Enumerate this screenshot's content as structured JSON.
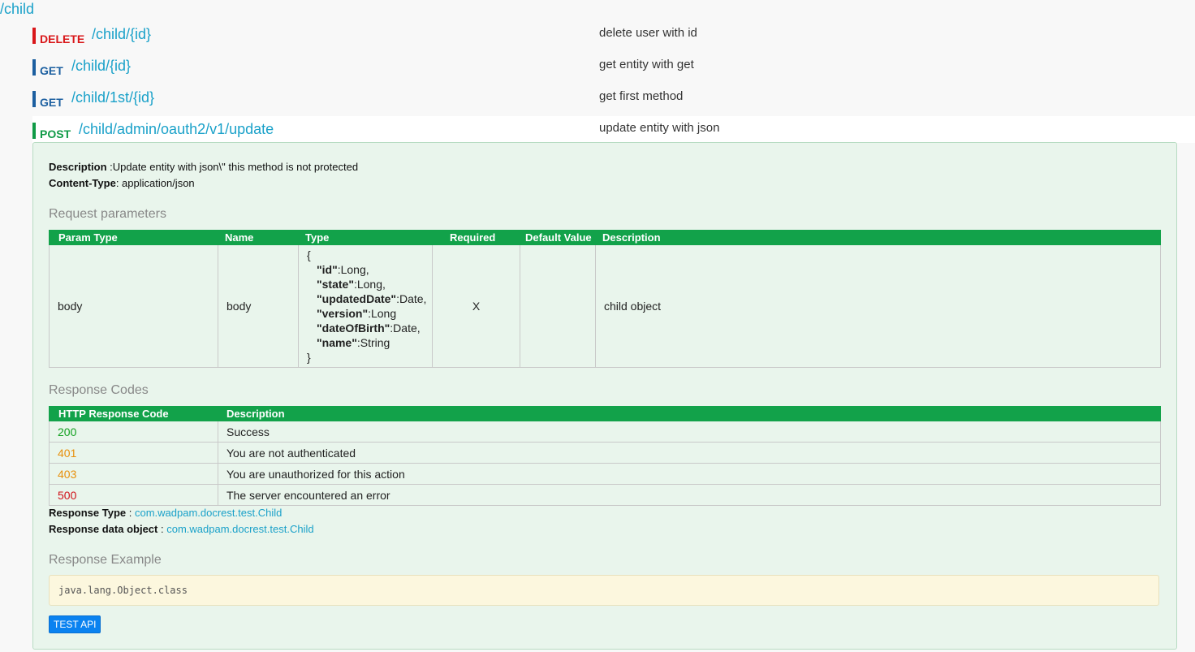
{
  "group": {
    "title": "/child"
  },
  "endpoints": [
    {
      "method": "DELETE",
      "path": "/child/{id}",
      "summary": "delete user with id"
    },
    {
      "method": "GET",
      "path": "/child/{id}",
      "summary": "get entity with get"
    },
    {
      "method": "GET",
      "path": "/child/1st/{id}",
      "summary": "get first method"
    },
    {
      "method": "POST",
      "path": "/child/admin/oauth2/v1/update",
      "summary": "update entity with json"
    }
  ],
  "details": {
    "description_label": "Description",
    "description_value": " :Update entity with json\\\" this method is not protected",
    "content_type_label": "Content-Type",
    "content_type_value": ": application/json",
    "request_params_title": "Request parameters",
    "param_headers": [
      "Param Type",
      "Name",
      "Type",
      "Required",
      "Default Value",
      "Description"
    ],
    "param_row": {
      "param_type": "body",
      "name": "body",
      "type_open": "{",
      "type_close": "}",
      "fields": [
        {
          "key": "\"id\"",
          "val": ":Long,"
        },
        {
          "key": "\"state\"",
          "val": ":Long,"
        },
        {
          "key": "\"updatedDate\"",
          "val": ":Date,"
        },
        {
          "key": "\"version\"",
          "val": ":Long"
        },
        {
          "key": "\"dateOfBirth\"",
          "val": ":Date,"
        },
        {
          "key": "\"name\"",
          "val": ":String"
        }
      ],
      "required": "X",
      "default_value": "",
      "description": "child object"
    },
    "response_codes_title": "Response Codes",
    "code_headers": [
      "HTTP Response Code",
      "Description"
    ],
    "codes": [
      {
        "code": "200",
        "desc": "Success"
      },
      {
        "code": "401",
        "desc": "You are not authenticated"
      },
      {
        "code": "403",
        "desc": "You are unauthorized for this action"
      },
      {
        "code": "500",
        "desc": "The server encountered an error"
      }
    ],
    "response_type_label": "Response Type",
    "response_type_sep": " : ",
    "response_type_value": "com.wadpam.docrest.test.Child",
    "response_data_label": "Response data object",
    "response_data_sep": " : ",
    "response_data_value": "com.wadpam.docrest.test.Child",
    "response_example_title": "Response Example",
    "response_example": "java.lang.Object.class",
    "test_button": "TEST API"
  }
}
